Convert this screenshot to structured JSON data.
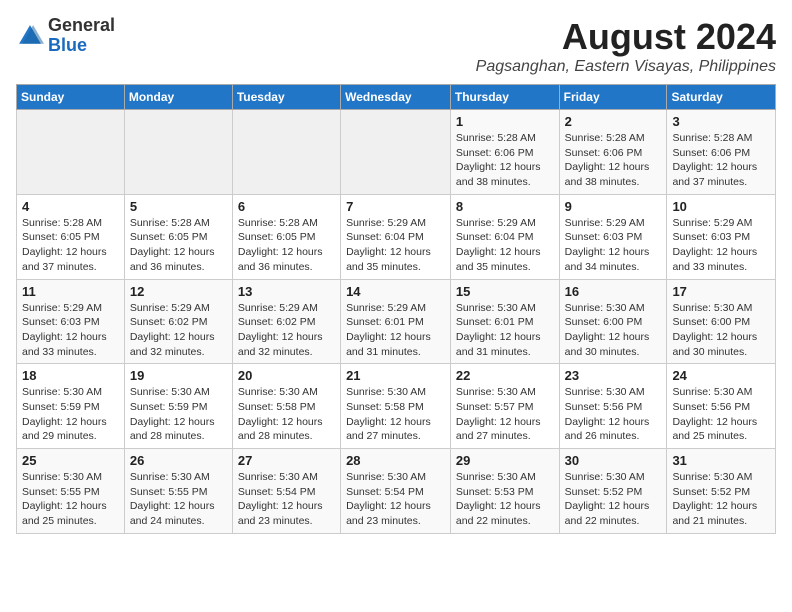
{
  "header": {
    "logo_general": "General",
    "logo_blue": "Blue",
    "main_title": "August 2024",
    "subtitle": "Pagsanghan, Eastern Visayas, Philippines"
  },
  "calendar": {
    "headers": [
      "Sunday",
      "Monday",
      "Tuesday",
      "Wednesday",
      "Thursday",
      "Friday",
      "Saturday"
    ],
    "weeks": [
      [
        {
          "day": "",
          "detail": ""
        },
        {
          "day": "",
          "detail": ""
        },
        {
          "day": "",
          "detail": ""
        },
        {
          "day": "",
          "detail": ""
        },
        {
          "day": "1",
          "detail": "Sunrise: 5:28 AM\nSunset: 6:06 PM\nDaylight: 12 hours\nand 38 minutes."
        },
        {
          "day": "2",
          "detail": "Sunrise: 5:28 AM\nSunset: 6:06 PM\nDaylight: 12 hours\nand 38 minutes."
        },
        {
          "day": "3",
          "detail": "Sunrise: 5:28 AM\nSunset: 6:06 PM\nDaylight: 12 hours\nand 37 minutes."
        }
      ],
      [
        {
          "day": "4",
          "detail": "Sunrise: 5:28 AM\nSunset: 6:05 PM\nDaylight: 12 hours\nand 37 minutes."
        },
        {
          "day": "5",
          "detail": "Sunrise: 5:28 AM\nSunset: 6:05 PM\nDaylight: 12 hours\nand 36 minutes."
        },
        {
          "day": "6",
          "detail": "Sunrise: 5:28 AM\nSunset: 6:05 PM\nDaylight: 12 hours\nand 36 minutes."
        },
        {
          "day": "7",
          "detail": "Sunrise: 5:29 AM\nSunset: 6:04 PM\nDaylight: 12 hours\nand 35 minutes."
        },
        {
          "day": "8",
          "detail": "Sunrise: 5:29 AM\nSunset: 6:04 PM\nDaylight: 12 hours\nand 35 minutes."
        },
        {
          "day": "9",
          "detail": "Sunrise: 5:29 AM\nSunset: 6:03 PM\nDaylight: 12 hours\nand 34 minutes."
        },
        {
          "day": "10",
          "detail": "Sunrise: 5:29 AM\nSunset: 6:03 PM\nDaylight: 12 hours\nand 33 minutes."
        }
      ],
      [
        {
          "day": "11",
          "detail": "Sunrise: 5:29 AM\nSunset: 6:03 PM\nDaylight: 12 hours\nand 33 minutes."
        },
        {
          "day": "12",
          "detail": "Sunrise: 5:29 AM\nSunset: 6:02 PM\nDaylight: 12 hours\nand 32 minutes."
        },
        {
          "day": "13",
          "detail": "Sunrise: 5:29 AM\nSunset: 6:02 PM\nDaylight: 12 hours\nand 32 minutes."
        },
        {
          "day": "14",
          "detail": "Sunrise: 5:29 AM\nSunset: 6:01 PM\nDaylight: 12 hours\nand 31 minutes."
        },
        {
          "day": "15",
          "detail": "Sunrise: 5:30 AM\nSunset: 6:01 PM\nDaylight: 12 hours\nand 31 minutes."
        },
        {
          "day": "16",
          "detail": "Sunrise: 5:30 AM\nSunset: 6:00 PM\nDaylight: 12 hours\nand 30 minutes."
        },
        {
          "day": "17",
          "detail": "Sunrise: 5:30 AM\nSunset: 6:00 PM\nDaylight: 12 hours\nand 30 minutes."
        }
      ],
      [
        {
          "day": "18",
          "detail": "Sunrise: 5:30 AM\nSunset: 5:59 PM\nDaylight: 12 hours\nand 29 minutes."
        },
        {
          "day": "19",
          "detail": "Sunrise: 5:30 AM\nSunset: 5:59 PM\nDaylight: 12 hours\nand 28 minutes."
        },
        {
          "day": "20",
          "detail": "Sunrise: 5:30 AM\nSunset: 5:58 PM\nDaylight: 12 hours\nand 28 minutes."
        },
        {
          "day": "21",
          "detail": "Sunrise: 5:30 AM\nSunset: 5:58 PM\nDaylight: 12 hours\nand 27 minutes."
        },
        {
          "day": "22",
          "detail": "Sunrise: 5:30 AM\nSunset: 5:57 PM\nDaylight: 12 hours\nand 27 minutes."
        },
        {
          "day": "23",
          "detail": "Sunrise: 5:30 AM\nSunset: 5:56 PM\nDaylight: 12 hours\nand 26 minutes."
        },
        {
          "day": "24",
          "detail": "Sunrise: 5:30 AM\nSunset: 5:56 PM\nDaylight: 12 hours\nand 25 minutes."
        }
      ],
      [
        {
          "day": "25",
          "detail": "Sunrise: 5:30 AM\nSunset: 5:55 PM\nDaylight: 12 hours\nand 25 minutes."
        },
        {
          "day": "26",
          "detail": "Sunrise: 5:30 AM\nSunset: 5:55 PM\nDaylight: 12 hours\nand 24 minutes."
        },
        {
          "day": "27",
          "detail": "Sunrise: 5:30 AM\nSunset: 5:54 PM\nDaylight: 12 hours\nand 23 minutes."
        },
        {
          "day": "28",
          "detail": "Sunrise: 5:30 AM\nSunset: 5:54 PM\nDaylight: 12 hours\nand 23 minutes."
        },
        {
          "day": "29",
          "detail": "Sunrise: 5:30 AM\nSunset: 5:53 PM\nDaylight: 12 hours\nand 22 minutes."
        },
        {
          "day": "30",
          "detail": "Sunrise: 5:30 AM\nSunset: 5:52 PM\nDaylight: 12 hours\nand 22 minutes."
        },
        {
          "day": "31",
          "detail": "Sunrise: 5:30 AM\nSunset: 5:52 PM\nDaylight: 12 hours\nand 21 minutes."
        }
      ]
    ]
  }
}
